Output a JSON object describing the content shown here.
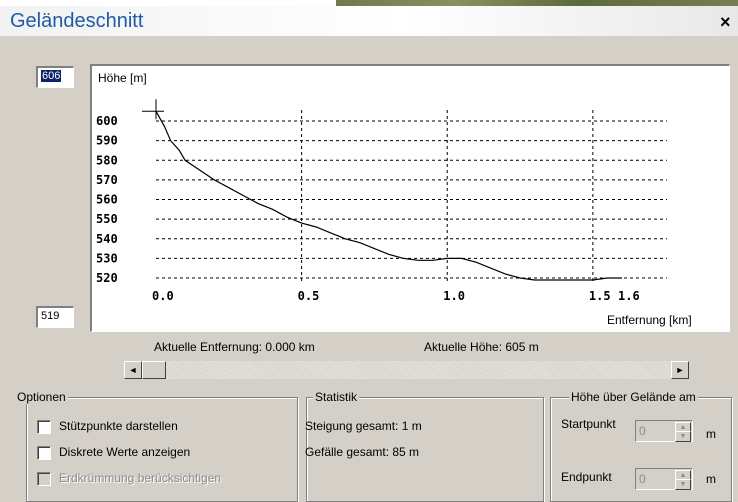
{
  "window": {
    "title": "Geländeschnitt",
    "close_label": "×"
  },
  "profile": {
    "max_height_value": "606",
    "min_height_value": "519",
    "current_distance": "Aktuelle Entfernung: 0.000 km",
    "current_height": "Aktuelle Höhe: 605 m"
  },
  "chart_data": {
    "type": "line",
    "ylabel": "Höhe [m]",
    "xlabel": "Entfernung [km]",
    "y_ticks": [
      600,
      590,
      580,
      570,
      560,
      550,
      540,
      530,
      520
    ],
    "x_ticks": [
      0.0,
      0.5,
      1.0,
      1.5,
      1.6
    ],
    "x_tick_labels": [
      "0.0",
      "0.5",
      "1.0",
      "1.5",
      "1.6"
    ],
    "xlim": [
      0,
      1.6
    ],
    "ylim": [
      519,
      606
    ],
    "grid": true,
    "x": [
      0.0,
      0.03,
      0.05,
      0.08,
      0.1,
      0.15,
      0.2,
      0.25,
      0.3,
      0.35,
      0.4,
      0.45,
      0.5,
      0.55,
      0.6,
      0.65,
      0.7,
      0.75,
      0.8,
      0.85,
      0.9,
      0.95,
      1.0,
      1.05,
      1.1,
      1.15,
      1.2,
      1.25,
      1.3,
      1.35,
      1.4,
      1.45,
      1.5,
      1.55,
      1.6
    ],
    "y": [
      605,
      597,
      590,
      585,
      580,
      575,
      570,
      566,
      562,
      558,
      555,
      551,
      548,
      546,
      543,
      540,
      538,
      535,
      532,
      530,
      529,
      529,
      530,
      530,
      528,
      525,
      522,
      520,
      519,
      519,
      519,
      519,
      519,
      520,
      520
    ]
  },
  "options": {
    "legend": "Optionen",
    "items": [
      "Stützpunkte darstellen",
      "Diskrete Werte anzeigen",
      "Erdkrümmung berücksichtigen"
    ]
  },
  "statistics": {
    "legend": "Statistik",
    "ascent": "Steigung gesamt: 1 m",
    "descent": "Gefälle gesamt: 85 m"
  },
  "height_above": {
    "legend": "Höhe über Gelände am",
    "start_label": "Startpunkt",
    "end_label": "Endpunkt",
    "start_value": "0",
    "end_value": "0",
    "unit": "m"
  },
  "scrollbar": {
    "left_arrow": "◄",
    "right_arrow": "►"
  }
}
